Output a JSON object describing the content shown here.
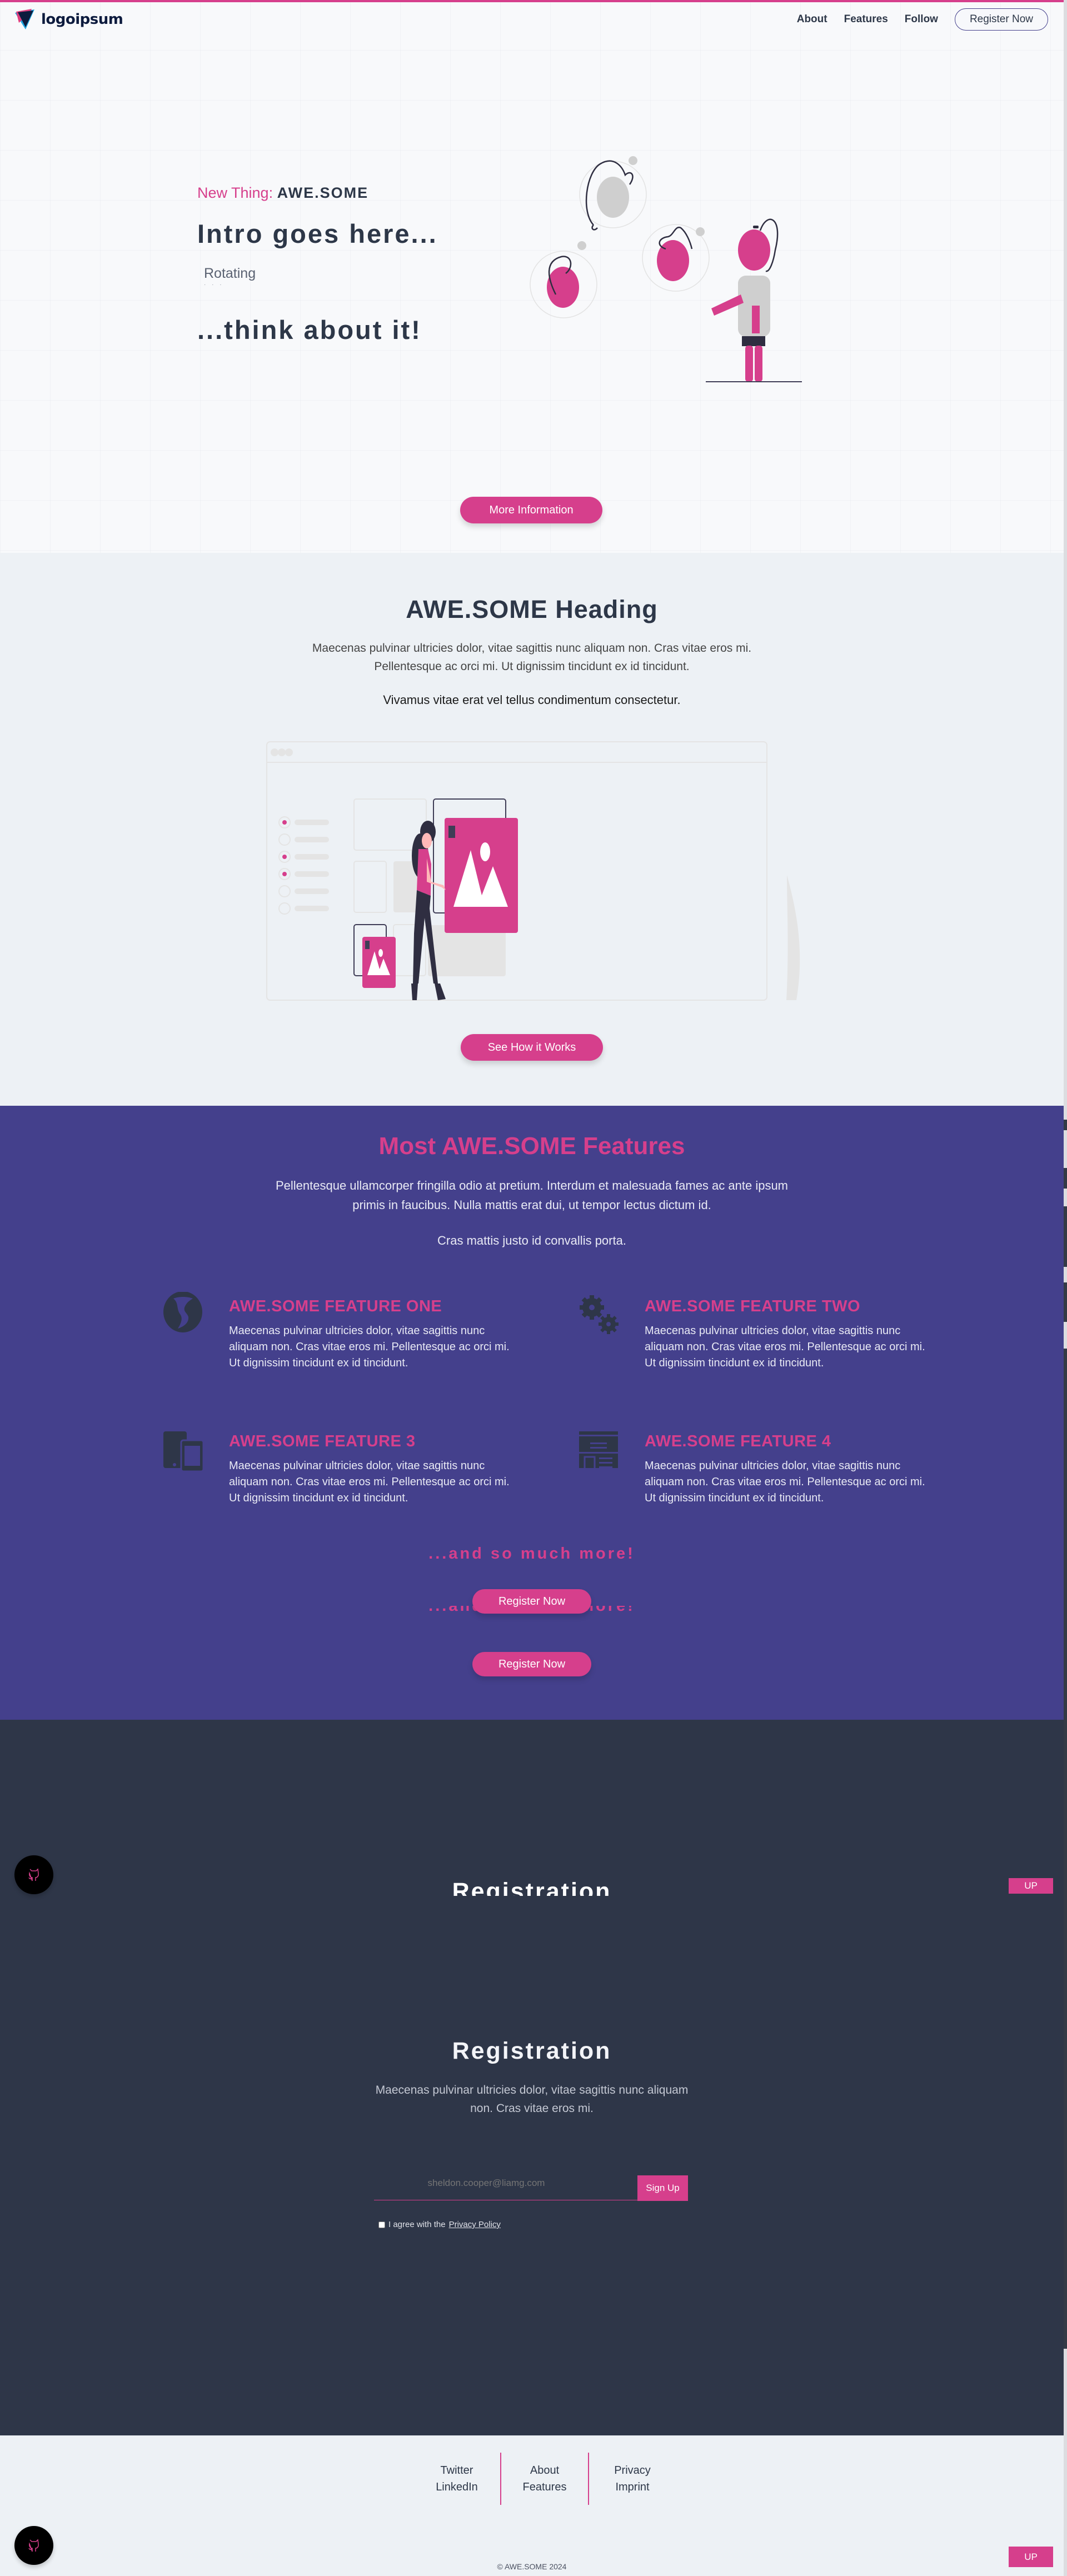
{
  "header": {
    "logo_text": "logoipsum",
    "nav": [
      "About",
      "Features",
      "Follow"
    ],
    "register_label": "Register Now"
  },
  "hero": {
    "eyebrow_prefix": "New Thing:",
    "eyebrow_brand": "AWE.SOME",
    "title": "Intro goes here...",
    "rotating_text": "Rotating",
    "rotating_dots": "· · ·",
    "subtitle": "...think about it!",
    "cta_label": "More Information"
  },
  "section_intro": {
    "heading": "AWE.SOME Heading",
    "lead_line1": "Maecenas pulvinar ultricies dolor, vitae sagittis nunc aliquam non. Cras vitae eros mi.",
    "lead_line2": "Pellentesque ac orci mi. Ut dignissim tincidunt ex id tincidunt.",
    "sub": "Vivamus vitae erat vel tellus condimentum consectetur.",
    "cta_label": "See How it Works"
  },
  "features": {
    "heading": "Most AWE.SOME Features",
    "lead_line1": "Pellentesque ullamcorper fringilla odio at pretium. Interdum et malesuada fames ac ante ipsum",
    "lead_line2": "primis in faucibus. Nulla mattis erat dui, ut tempor lectus dictum id.",
    "sub": "Cras mattis justo id convallis porta.",
    "items": [
      {
        "title": "AWE.SOME FEATURE ONE",
        "icon": "globe-icon",
        "text": "Maecenas pulvinar ultricies dolor, vitae sagittis nunc aliquam non. Cras vitae eros mi. Pellentesque ac orci mi. Ut dignissim tincidunt ex id tincidunt."
      },
      {
        "title": "AWE.SOME FEATURE TWO",
        "icon": "gears-icon",
        "text": "Maecenas pulvinar ultricies dolor, vitae sagittis nunc aliquam non. Cras vitae eros mi. Pellentesque ac orci mi. Ut dignissim tincidunt ex id tincidunt."
      },
      {
        "title": "AWE.SOME FEATURE 3",
        "icon": "devices-icon",
        "text": "Maecenas pulvinar ultricies dolor, vitae sagittis nunc aliquam non. Cras vitae eros mi. Pellentesque ac orci mi. Ut dignissim tincidunt ex id tincidunt."
      },
      {
        "title": "AWE.SOME FEATURE 4",
        "icon": "newspaper-icon",
        "text": "Maecenas pulvinar ultricies dolor, vitae sagittis nunc aliquam non. Cras vitae eros mi. Pellentesque ac orci mi. Ut dignissim tincidunt ex id tincidunt."
      }
    ],
    "more_text": "...and so much more!",
    "register_label": "Register Now"
  },
  "registration": {
    "heading": "Registration",
    "lead_line1": "Maecenas pulvinar ultricies dolor, vitae sagittis nunc aliquam",
    "lead_line2": "non. Cras vitae eros mi.",
    "email_placeholder": "sheldon.cooper@liamg.com",
    "signup_label": "Sign Up",
    "agree_text": "I agree with the",
    "privacy_link": "Privacy Policy"
  },
  "floating": {
    "up_label": "UP",
    "github_icon": "github-icon"
  },
  "footer": {
    "columns": [
      [
        "Twitter",
        "LinkedIn"
      ],
      [
        "About",
        "Features"
      ],
      [
        "Privacy",
        "Imprint"
      ]
    ],
    "copyright": "© AWE.SOME 2024"
  },
  "colors": {
    "accent": "#d63f8c",
    "purple": "#44408c",
    "dark": "#2e3648",
    "light": "#edf1f5",
    "text": "#2d3748"
  }
}
